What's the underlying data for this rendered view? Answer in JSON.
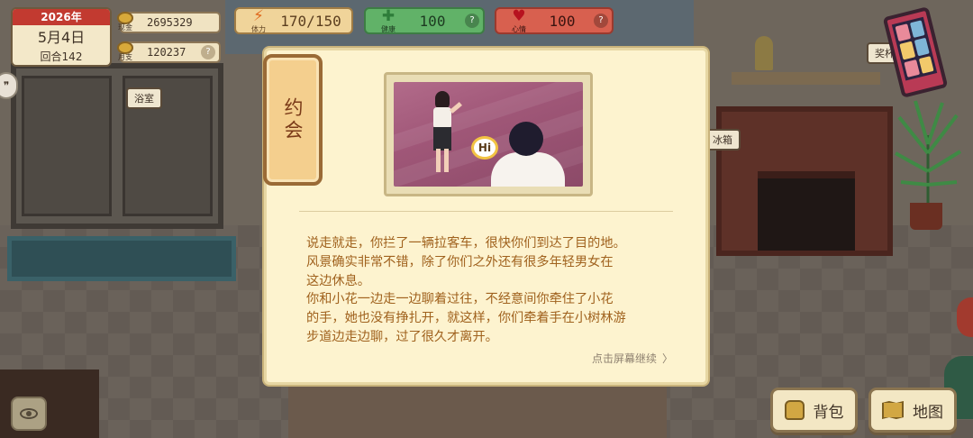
{
  "hud": {
    "year": "2026年",
    "date": "5月4日",
    "turn": "回合142",
    "cash_label": "现金",
    "cash_value": "2695329",
    "monthly_label": "月支",
    "monthly_value": "120237",
    "help_glyph": "?"
  },
  "stats": {
    "energy": {
      "label": "体力",
      "value": "170/150",
      "icon": "lightning-icon"
    },
    "health": {
      "label": "健康",
      "value": "100",
      "icon": "plus-cross-icon"
    },
    "mood": {
      "label": "心情",
      "value": "100",
      "icon": "heart-icon"
    }
  },
  "scene": {
    "bathroom_label": "浴室",
    "fridge_label": "冰箱",
    "reward_label": "奖杯"
  },
  "dialog": {
    "tag": "约会",
    "bubble_text": "Hi",
    "paragraph1": "说走就走，你拦了一辆拉客车，很快你们到达了目的地。\n风景确实非常不错，除了你们之外还有很多年轻男女在\n这边休息。",
    "paragraph2": "你和小花一边走一边聊着过往，不经意间你牵住了小花\n的手，她也没有挣扎开，就这样，你们牵着手在小树林游\n步道边走边聊，过了很久才离开。",
    "continue_text": "点击屏幕继续",
    "continue_arrow": "〉"
  },
  "buttons": {
    "bag": "背包",
    "map": "地图"
  },
  "colors": {
    "accent_red": "#c23a30",
    "health_green": "#61b268",
    "mood_red": "#d8604f",
    "story_text": "#a0621e"
  }
}
